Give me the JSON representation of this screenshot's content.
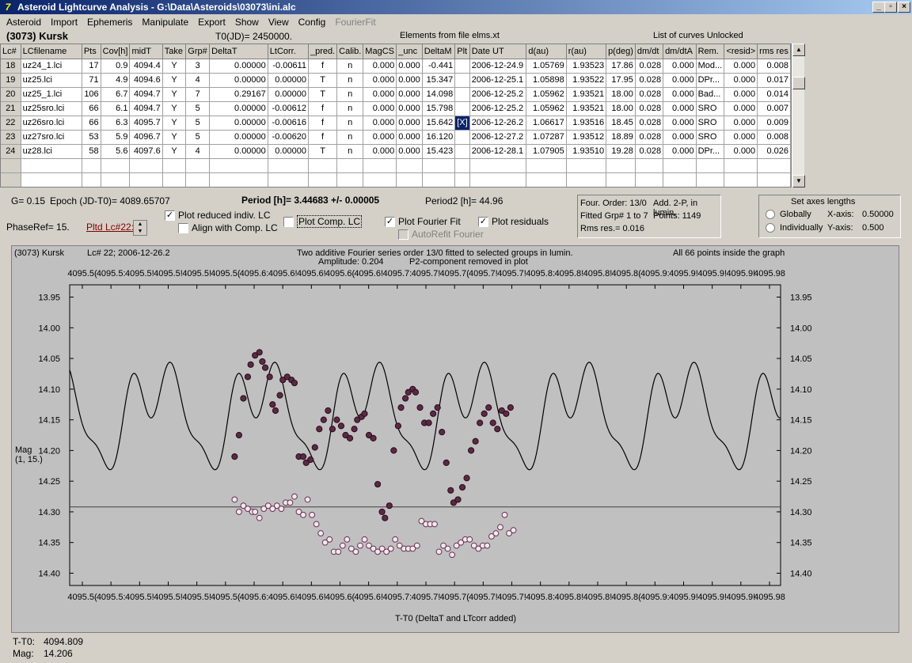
{
  "window": {
    "title": "Asteroid Lightcurve Analysis - G:\\Data\\Asteroids\\03073\\ini.alc",
    "icon": "app-icon",
    "min": "_",
    "max": "▫",
    "close": "×"
  },
  "menu": [
    "Asteroid",
    "Import",
    "Ephemeris",
    "Manipulate",
    "Export",
    "Show",
    "View",
    "Config"
  ],
  "menu_disabled": "FourierFit",
  "header": {
    "asteroid": "(3073) Kursk",
    "t0": "T0(JD)= 2450000.",
    "elements": "Elements from file elms.xt",
    "curves": "List of curves Unlocked"
  },
  "table": {
    "columns": [
      "Lc#",
      "LCfilename",
      "Pts",
      "Cov[h]",
      "midT",
      "Take",
      "Grp#",
      "DeltaT",
      "LtCorr.",
      "_pred.",
      "Calib.",
      "MagCS",
      "_unc",
      "DeltaM",
      "Plt",
      "Date UT",
      "d(au)",
      "r(au)",
      "p(deg)",
      "dm/dt",
      "dm/dtA",
      "Rem.",
      "<resid>",
      "rms res"
    ],
    "rows": [
      [
        "18",
        "uz24_1.lci",
        "17",
        "0.9",
        "4094.4",
        "Y",
        "3",
        "0.00000",
        "-0.00611",
        "f",
        "n",
        "0.000",
        "0.000",
        "-0.441",
        "",
        "2006-12-24.9",
        "1.05769",
        "1.93523",
        "17.86",
        "0.028",
        "0.000",
        "Mod...",
        "0.000",
        "0.008"
      ],
      [
        "19",
        "uz25.lci",
        "71",
        "4.9",
        "4094.6",
        "Y",
        "4",
        "0.00000",
        "0.00000",
        "T",
        "n",
        "0.000",
        "0.000",
        "15.347",
        "",
        "2006-12-25.1",
        "1.05898",
        "1.93522",
        "17.95",
        "0.028",
        "0.000",
        "DPr...",
        "0.000",
        "0.017"
      ],
      [
        "20",
        "uz25_1.lci",
        "106",
        "6.7",
        "4094.7",
        "Y",
        "7",
        "0.29167",
        "0.00000",
        "T",
        "n",
        "0.000",
        "0.000",
        "14.098",
        "",
        "2006-12-25.2",
        "1.05962",
        "1.93521",
        "18.00",
        "0.028",
        "0.000",
        "Bad...",
        "0.000",
        "0.014"
      ],
      [
        "21",
        "uz25sro.lci",
        "66",
        "6.1",
        "4094.7",
        "Y",
        "5",
        "0.00000",
        "-0.00612",
        "f",
        "n",
        "0.000",
        "0.000",
        "15.798",
        "",
        "2006-12-25.2",
        "1.05962",
        "1.93521",
        "18.00",
        "0.028",
        "0.000",
        "SRO",
        "0.000",
        "0.007"
      ],
      [
        "22",
        "uz26sro.lci",
        "66",
        "6.3",
        "4095.7",
        "Y",
        "5",
        "0.00000",
        "-0.00616",
        "f",
        "n",
        "0.000",
        "0.000",
        "15.642",
        "[X]",
        "2006-12-26.2",
        "1.06617",
        "1.93516",
        "18.45",
        "0.028",
        "0.000",
        "SRO",
        "0.000",
        "0.009"
      ],
      [
        "23",
        "uz27sro.lci",
        "53",
        "5.9",
        "4096.7",
        "Y",
        "5",
        "0.00000",
        "-0.00620",
        "f",
        "n",
        "0.000",
        "0.000",
        "16.120",
        "",
        "2006-12-27.2",
        "1.07287",
        "1.93512",
        "18.89",
        "0.028",
        "0.000",
        "SRO",
        "0.000",
        "0.008"
      ],
      [
        "24",
        "uz28.lci",
        "58",
        "5.6",
        "4097.6",
        "Y",
        "4",
        "0.00000",
        "0.00000",
        "T",
        "n",
        "0.000",
        "0.000",
        "15.423",
        "",
        "2006-12-28.1",
        "1.07905",
        "1.93510",
        "19.28",
        "0.028",
        "0.000",
        "DPr...",
        "0.000",
        "0.026"
      ]
    ]
  },
  "controls": {
    "g": "G= 0.15",
    "epoch": "Epoch (JD-T0)= 4089.65707",
    "period": "Period [h]= 3.44683 +/- 0.00005",
    "period2": "Period2 [h]= 44.96",
    "phaseref": "PhaseRef= 15.",
    "pltd": "Pltd Lc#22:",
    "plot_reduced": "Plot reduced indiv. LC",
    "align_comp": "Align with Comp. LC",
    "plot_comp": "Plot Comp. LC",
    "plot_fourier": "Plot Fourier Fit",
    "plot_resid": "Plot residuals",
    "autorefit": "AutoRefit Fourier",
    "check": "✓"
  },
  "fourier": {
    "order": "Four. Order: 13/0",
    "add": "Add. 2-P, in lumin.",
    "fitted": "Fitted Grp# 1 to 7",
    "points": "Points: 1149",
    "rms": "Rms res.= 0.016"
  },
  "axes": {
    "title": "Set axes lengths",
    "globally": "Globally",
    "individually": "Individually",
    "xaxis": "X-axis:",
    "xval": "0.50000",
    "yaxis": "Y-axis:",
    "yval": "0.500"
  },
  "plot": {
    "left_title": "(3073) Kursk",
    "lc": "Lc# 22; 2006-12-26.2",
    "center1": "Two additive Fourier series order 13/0 fitted to selected groups in lumin.",
    "amp": "Amplitude: 0.204",
    "p2": "P2-component removed in plot",
    "right_title": "All 66 points inside the graph",
    "xlabel": "T-T0 (DeltaT and LTcorr added)",
    "ylabel1": "Mag",
    "ylabel2": "(1, 15.)",
    "xticks": [
      "4095.5(",
      "4095.5:",
      "4095.5!",
      "4095.5!",
      "4095.5!",
      "4095.5(",
      "4095.6:",
      "4095.6!",
      "4095.6!",
      "4095.6(",
      "4095.6!",
      "4095.7:",
      "4095.7!",
      "4095.7(",
      "4095.7!",
      "4095.7!",
      "4095.8:",
      "4095.8!",
      "4095.8!",
      "4095.8(",
      "4095.9:",
      "4095.9!",
      "4095.9!",
      "4095.9!",
      "4095.98"
    ],
    "yticks": [
      "13.95",
      "14.00",
      "14.05",
      "14.10",
      "14.15",
      "14.20",
      "14.25",
      "14.30",
      "14.35",
      "14.40"
    ]
  },
  "chart_data": {
    "type": "scatter",
    "ylim": [
      14.42,
      13.93
    ],
    "xlabel": "T-T0 (DeltaT and LTcorr added)",
    "ylabel": "Mag",
    "ref_line": 14.292,
    "series": [
      {
        "values": [
          [
            4095.608,
            14.21
          ],
          [
            4095.611,
            14.175
          ],
          [
            4095.614,
            14.115
          ],
          [
            4095.617,
            14.08
          ],
          [
            4095.619,
            14.06
          ],
          [
            4095.622,
            14.045
          ],
          [
            4095.625,
            14.04
          ],
          [
            4095.627,
            14.055
          ],
          [
            4095.629,
            14.065
          ],
          [
            4095.632,
            14.08
          ],
          [
            4095.634,
            14.125
          ],
          [
            4095.636,
            14.135
          ],
          [
            4095.639,
            14.11
          ],
          [
            4095.641,
            14.085
          ],
          [
            4095.644,
            14.08
          ],
          [
            4095.647,
            14.085
          ],
          [
            4095.649,
            14.09
          ],
          [
            4095.652,
            14.21
          ],
          [
            4095.655,
            14.21
          ],
          [
            4095.657,
            14.22
          ],
          [
            4095.66,
            14.215
          ],
          [
            4095.663,
            14.195
          ],
          [
            4095.666,
            14.165
          ],
          [
            4095.669,
            14.15
          ],
          [
            4095.672,
            14.135
          ],
          [
            4095.675,
            14.165
          ],
          [
            4095.678,
            14.15
          ],
          [
            4095.681,
            14.16
          ],
          [
            4095.684,
            14.175
          ],
          [
            4095.687,
            14.18
          ],
          [
            4095.69,
            14.165
          ],
          [
            4095.692,
            14.15
          ],
          [
            4095.695,
            14.145
          ],
          [
            4095.697,
            14.14
          ],
          [
            4095.7,
            14.175
          ],
          [
            4095.703,
            14.18
          ],
          [
            4095.706,
            14.255
          ],
          [
            4095.709,
            14.3
          ],
          [
            4095.711,
            14.31
          ],
          [
            4095.714,
            14.29
          ],
          [
            4095.717,
            14.2
          ],
          [
            4095.72,
            14.16
          ],
          [
            4095.722,
            14.13
          ],
          [
            4095.725,
            14.115
          ],
          [
            4095.727,
            14.105
          ],
          [
            4095.73,
            14.1
          ],
          [
            4095.732,
            14.105
          ],
          [
            4095.735,
            14.13
          ],
          [
            4095.738,
            14.155
          ],
          [
            4095.741,
            14.155
          ],
          [
            4095.744,
            14.14
          ],
          [
            4095.747,
            14.13
          ],
          [
            4095.75,
            14.17
          ],
          [
            4095.753,
            14.22
          ],
          [
            4095.756,
            14.265
          ],
          [
            4095.758,
            14.285
          ],
          [
            4095.761,
            14.28
          ],
          [
            4095.764,
            14.26
          ],
          [
            4095.767,
            14.245
          ],
          [
            4095.77,
            14.2
          ],
          [
            4095.773,
            14.185
          ],
          [
            4095.776,
            14.155
          ],
          [
            4095.779,
            14.14
          ],
          [
            4095.782,
            14.13
          ],
          [
            4095.785,
            14.155
          ],
          [
            4095.788,
            14.165
          ],
          [
            4095.791,
            14.135
          ],
          [
            4095.794,
            14.14
          ],
          [
            4095.797,
            14.13
          ]
        ]
      },
      {
        "values": [
          [
            4095.608,
            14.28
          ],
          [
            4095.611,
            14.3
          ],
          [
            4095.614,
            14.29
          ],
          [
            4095.617,
            14.295
          ],
          [
            4095.62,
            14.3
          ],
          [
            4095.622,
            14.3
          ],
          [
            4095.625,
            14.31
          ],
          [
            4095.628,
            14.295
          ],
          [
            4095.631,
            14.29
          ],
          [
            4095.634,
            14.295
          ],
          [
            4095.637,
            14.29
          ],
          [
            4095.64,
            14.295
          ],
          [
            4095.643,
            14.285
          ],
          [
            4095.646,
            14.285
          ],
          [
            4095.649,
            14.275
          ],
          [
            4095.652,
            14.3
          ],
          [
            4095.655,
            14.305
          ],
          [
            4095.658,
            14.28
          ],
          [
            4095.661,
            14.305
          ],
          [
            4095.664,
            14.32
          ],
          [
            4095.667,
            14.335
          ],
          [
            4095.67,
            14.35
          ],
          [
            4095.673,
            14.345
          ],
          [
            4095.676,
            14.365
          ],
          [
            4095.679,
            14.365
          ],
          [
            4095.682,
            14.355
          ],
          [
            4095.685,
            14.345
          ],
          [
            4095.688,
            14.36
          ],
          [
            4095.691,
            14.365
          ],
          [
            4095.694,
            14.355
          ],
          [
            4095.697,
            14.345
          ],
          [
            4095.7,
            14.355
          ],
          [
            4095.703,
            14.36
          ],
          [
            4095.706,
            14.365
          ],
          [
            4095.709,
            14.36
          ],
          [
            4095.712,
            14.365
          ],
          [
            4095.715,
            14.36
          ],
          [
            4095.718,
            14.345
          ],
          [
            4095.721,
            14.355
          ],
          [
            4095.724,
            14.36
          ],
          [
            4095.727,
            14.36
          ],
          [
            4095.73,
            14.36
          ],
          [
            4095.733,
            14.355
          ],
          [
            4095.736,
            14.315
          ],
          [
            4095.739,
            14.32
          ],
          [
            4095.742,
            14.32
          ],
          [
            4095.745,
            14.32
          ],
          [
            4095.748,
            14.365
          ],
          [
            4095.751,
            14.355
          ],
          [
            4095.754,
            14.36
          ],
          [
            4095.757,
            14.37
          ],
          [
            4095.76,
            14.355
          ],
          [
            4095.763,
            14.35
          ],
          [
            4095.766,
            14.345
          ],
          [
            4095.769,
            14.345
          ],
          [
            4095.772,
            14.355
          ],
          [
            4095.775,
            14.36
          ],
          [
            4095.778,
            14.355
          ],
          [
            4095.781,
            14.355
          ],
          [
            4095.784,
            14.34
          ],
          [
            4095.787,
            14.335
          ],
          [
            4095.79,
            14.325
          ],
          [
            4095.793,
            14.305
          ],
          [
            4095.796,
            14.335
          ],
          [
            4095.799,
            14.33
          ]
        ]
      }
    ]
  },
  "status": {
    "tt0_label": "T-T0:",
    "tt0": "4094.809",
    "mag_label": "Mag:",
    "mag": "14.206"
  }
}
